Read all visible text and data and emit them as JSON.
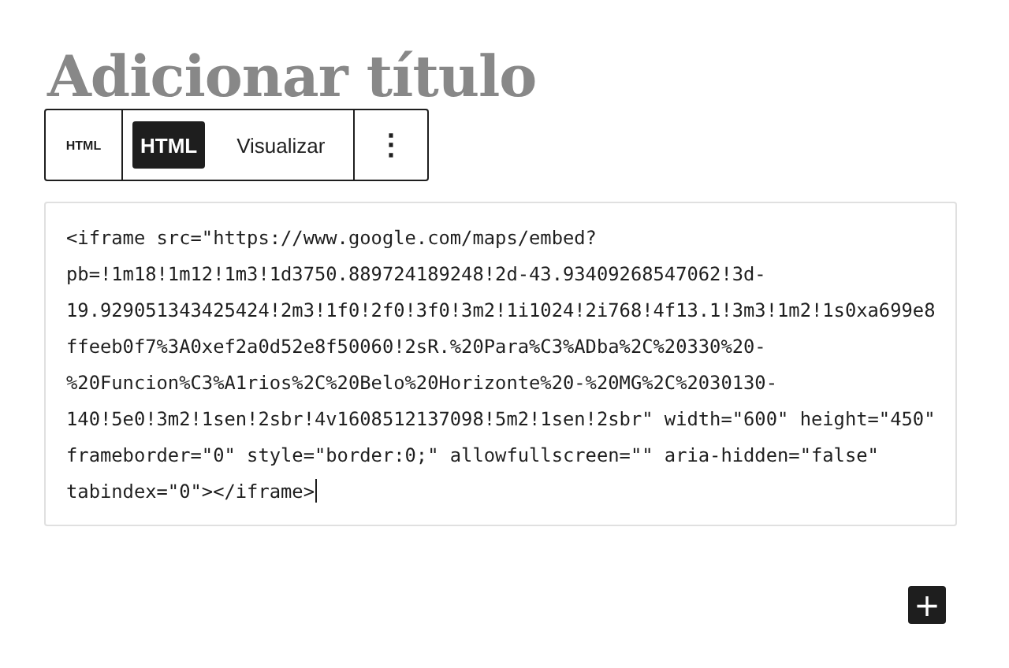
{
  "title": "Adicionar título",
  "toolbar": {
    "block_label": "HTML",
    "tabs": [
      {
        "label": "HTML",
        "selected": true
      },
      {
        "label": "Visualizar",
        "selected": false
      }
    ],
    "more": "⋮"
  },
  "code_lines": [
    "<iframe src=\"https://www.google.com/maps/embed?",
    "pb=!1m18!1m12!1m3!1d3750.889724189248!2d-43.93409268547062!3d-",
    "19.929051343425424!2m3!1f0!2f0!3f0!3m2!1i1024!2i768!4f13.1!3m3!1m2!1s0xa699e8",
    "ffeeb0f7%3A0xef2a0d52e8f50060!2sR.%20Para%C3%ADba%2C%20330%20-",
    "%20Funcion%C3%A1rios%2C%20Belo%20Horizonte%20-%20MG%2C%2030130-",
    "140!5e0!3m2!1sen!2sbr!4v1608512137098!5m2!1sen!2sbr\" width=\"600\" height=\"450\"",
    "frameborder=\"0\" style=\"border:0;\" allowfullscreen=\"\" aria-hidden=\"false\"",
    "tabindex=\"0\"></iframe>"
  ],
  "add_button": "+"
}
